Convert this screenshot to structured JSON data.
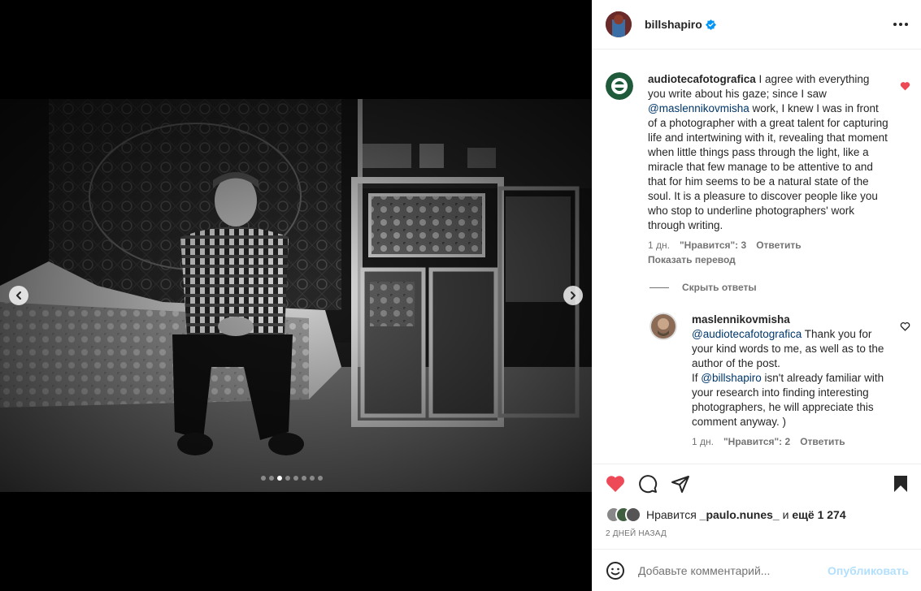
{
  "post": {
    "author": "billshapiro",
    "more_label": "More options",
    "carousel": {
      "count": 8,
      "active_index": 2
    }
  },
  "comments": [
    {
      "user": "audiotecafotografica",
      "text_before": " I agree with everything you write about his gaze; since I saw ",
      "mention": "@maslennikovmisha",
      "text_after": " work, I knew I was in front of a photographer with a great talent for capturing life and intertwining with it, revealing that moment when little things pass through the light, like a miracle that few manage to be attentive to and that for him seems to be a natural state of the soul. It is a pleasure to discover people like you who stop to underline photographers' work through writing.",
      "time": "1 дн.",
      "likes": "\"Нравится\": 3",
      "reply": "Ответить",
      "translate": "Показать перевод",
      "liked": true
    }
  ],
  "hide_replies": "Скрыть ответы",
  "reply": {
    "user": "maslennikovmisha",
    "mention1": "@audiotecafotografica",
    "text1": " Thank you for your kind words to me, as well as to the author of the post.",
    "text2_prefix": "If ",
    "mention2": "@billshapiro",
    "text2_suffix": " isn't already familiar with your research into finding interesting photographers, he will appreciate this comment anyway. )",
    "time": "1 дн.",
    "likes": "\"Нравится\": 2",
    "reply_label": "Ответить"
  },
  "likes_line": {
    "prefix": "Нравится ",
    "user": "_paulo.nunes_",
    "middle": " и ",
    "rest": "ещё 1 274"
  },
  "timestamp": "2 ДНЕЙ НАЗАД",
  "add_comment": {
    "placeholder": "Добавьте комментарий...",
    "publish": "Опубликовать"
  },
  "colors": {
    "heart": "#ed4956",
    "verified": "#0095f6",
    "link": "#00376b",
    "publish_disabled": "#b2dffc"
  }
}
